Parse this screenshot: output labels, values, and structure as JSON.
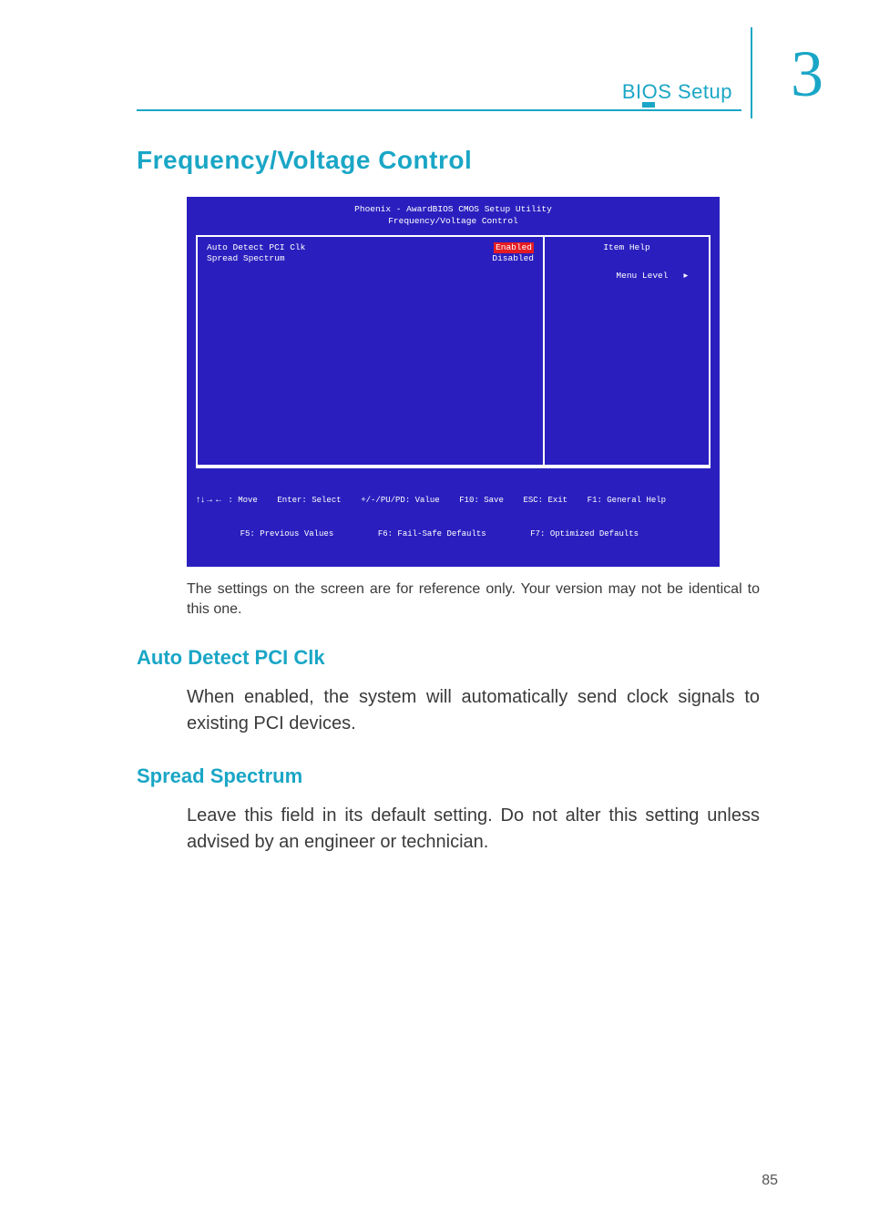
{
  "header": {
    "chapter_number": "3",
    "section_label": "BIOS Setup"
  },
  "section_title": "Frequency/Voltage  Control",
  "bios": {
    "top_line1": "Phoenix - AwardBIOS CMOS Setup Utility",
    "top_line2": "Frequency/Voltage Control",
    "options": [
      {
        "label": "Auto Detect PCI Clk",
        "value": "Enabled",
        "highlight": true
      },
      {
        "label": "Spread Spectrum",
        "value": "Disabled",
        "highlight": false
      }
    ],
    "help_title": "Item Help",
    "menu_level_label": "Menu Level   ",
    "footer_line1_prefix": " : Move    Enter: Select    +/-/PU/PD: Value    F10: Save    ESC: Exit    F1: General Help",
    "footer_line2": "         F5: Previous Values         F6: Fail-Safe Defaults         F7: Optimized Defaults"
  },
  "caption": "The settings on the screen are for reference only. Your version may not be identical to this one.",
  "subsections": [
    {
      "heading": "Auto Detect PCI Clk",
      "body": "When enabled, the system will automatically send clock signals to existing PCI devices."
    },
    {
      "heading": "Spread Spectrum",
      "body": "Leave this field in its default setting. Do not alter this setting unless advised by an engineer or technician."
    }
  ],
  "page_number": "85"
}
